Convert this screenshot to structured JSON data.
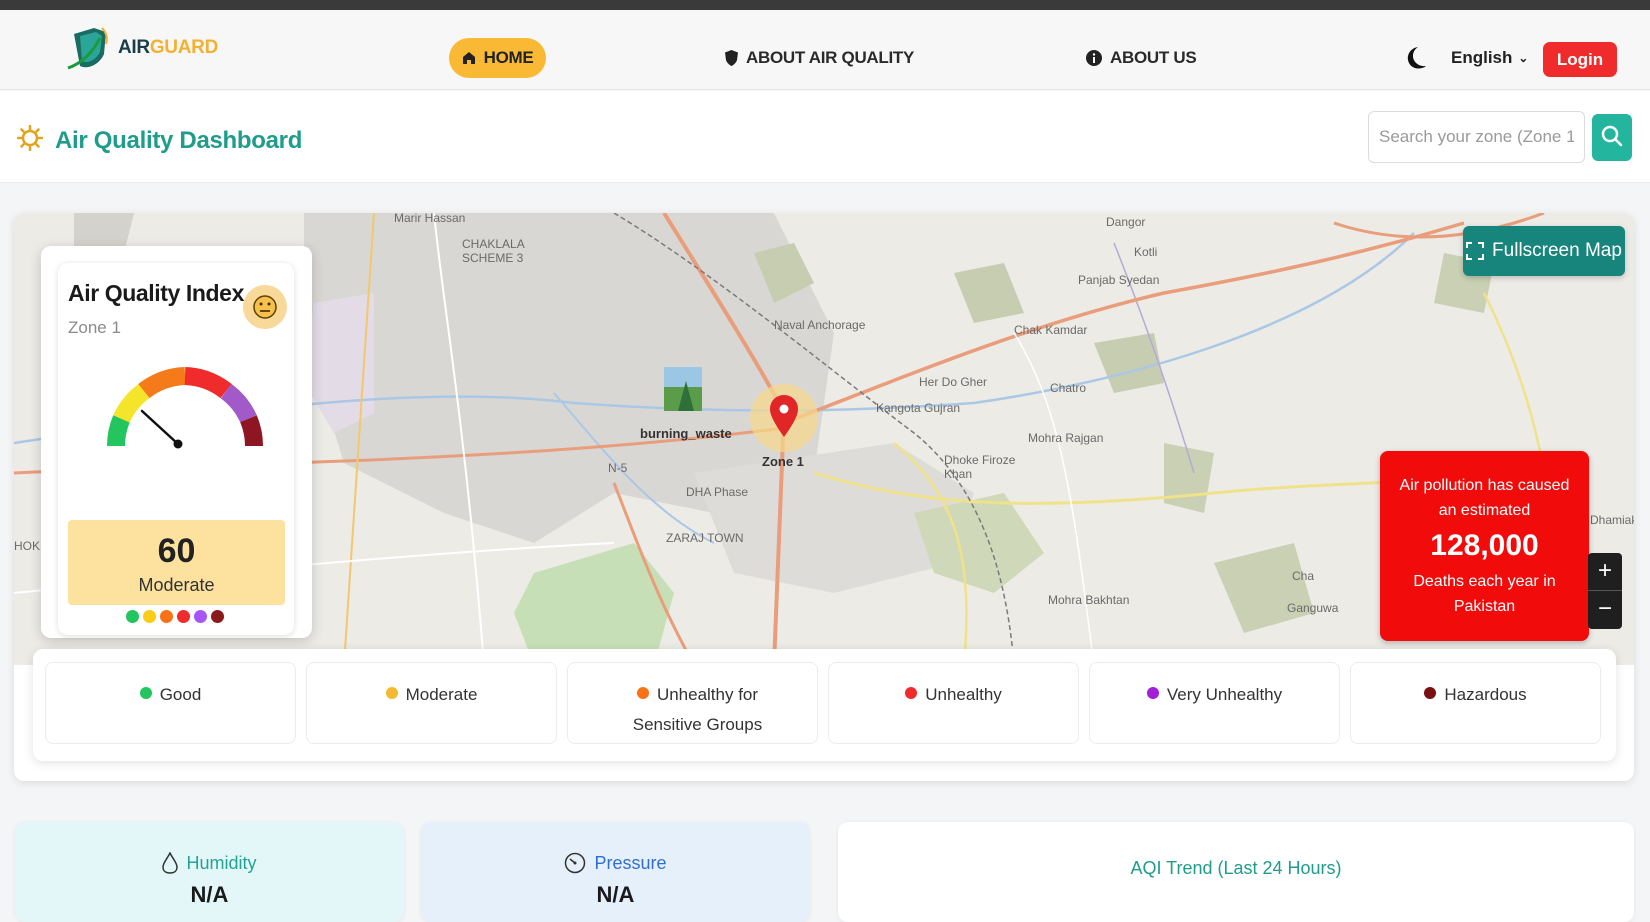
{
  "brand": {
    "name_part1": "AIR",
    "name_part2": "GUARD"
  },
  "nav": {
    "home": "HOME",
    "about_air_quality": "ABOUT AIR QUALITY",
    "about_us": "ABOUT US",
    "language": "English",
    "login": "Login"
  },
  "dashboard": {
    "title": "Air Quality Dashboard",
    "search_placeholder": "Search your zone (Zone 1"
  },
  "map": {
    "fullscreen_label": "Fullscreen Map",
    "zoom_in": "+",
    "zoom_out": "−",
    "marker_label": "Zone 1",
    "source_label": "burning_waste",
    "places": [
      "Marir Hassan",
      "CHAKLALA SCHEME 3",
      "Naval Anchorage",
      "Chak Kamdar",
      "Her Do Gher",
      "Kangota Gujran",
      "Chatro",
      "Mohra Rajgan",
      "Dhoke Firoze Khan",
      "ZARAJ TOWN",
      "DHA Phase",
      "Mohra Bakhtan",
      "Panjab Syedan",
      "Dangor",
      "Kotli",
      "N-5",
      "Cha",
      "Ganguwa",
      "Dhamiak",
      "HOK"
    ]
  },
  "pollution_notice": {
    "line1": "Air pollution has caused an estimated",
    "number": "128,000",
    "line2": "Deaths each year in Pakistan"
  },
  "aqi": {
    "title": "Air Quality Index",
    "zone": "Zone 1",
    "value": "60",
    "level": "Moderate",
    "face_icon": "neutral-face-icon",
    "dot_colors": [
      "#22c55e",
      "#facc15",
      "#f97316",
      "#ef2b2b",
      "#a855f7",
      "#8b1a1a"
    ]
  },
  "legend": [
    {
      "label": "Good",
      "color": "#22c55e"
    },
    {
      "label": "Moderate",
      "color": "#f5b82e"
    },
    {
      "label": "Unhealthy for Sensitive Groups",
      "color": "#f97316"
    },
    {
      "label": "Unhealthy",
      "color": "#ef2b2b"
    },
    {
      "label": "Very Unhealthy",
      "color": "#a11fd6"
    },
    {
      "label": "Hazardous",
      "color": "#7a0f12"
    }
  ],
  "stats": {
    "humidity_label": "Humidity",
    "humidity_value": "N/A",
    "pressure_label": "Pressure",
    "pressure_value": "N/A",
    "trend_title": "AQI Trend (Last 24 Hours)"
  },
  "colors": {
    "accent": "#1f9c8a",
    "home_pill": "#f9b935",
    "login": "#ef2b2b",
    "alert": "#f10b0b"
  }
}
